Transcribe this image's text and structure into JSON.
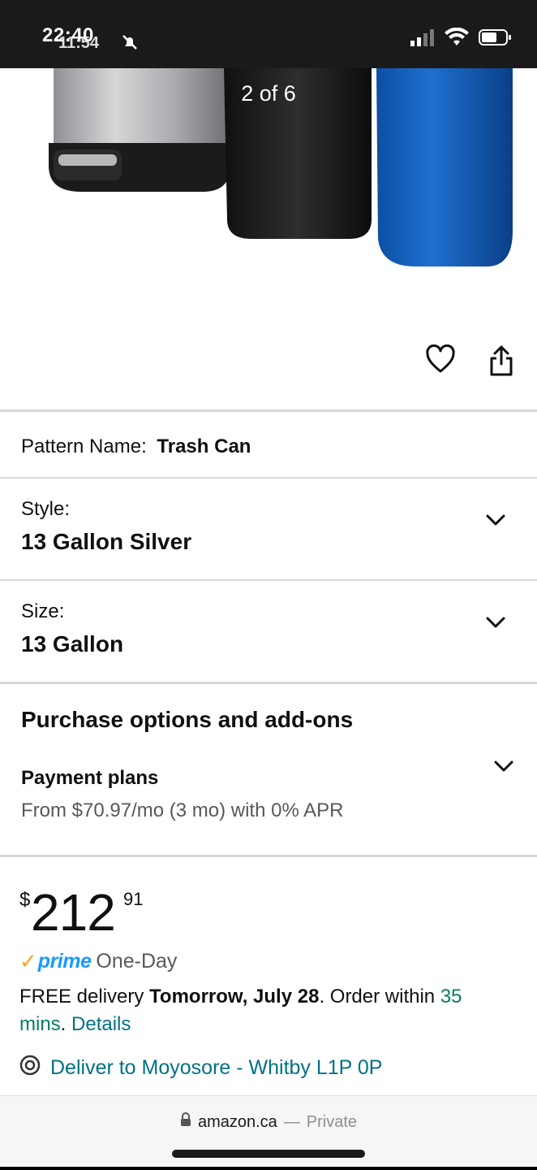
{
  "status_bar": {
    "time": "22:40",
    "time_overlay": "11:54"
  },
  "gallery": {
    "counter": "2 of 6"
  },
  "options": {
    "pattern_label": "Pattern Name:",
    "pattern_value": "Trash Can",
    "style_label": "Style:",
    "style_value": "13 Gallon Silver",
    "size_label": "Size:",
    "size_value": "13 Gallon"
  },
  "purchase": {
    "title": "Purchase options and add-ons",
    "payment_title": "Payment plans",
    "payment_sub": "From $70.97/mo (3 mo) with 0% APR"
  },
  "price": {
    "symbol": "$",
    "whole": "212",
    "fraction": "91"
  },
  "prime": {
    "check": "✓",
    "word": "prime",
    "speed": "One-Day"
  },
  "delivery": {
    "prefix": "FREE delivery ",
    "date": "Tomorrow, July 28",
    "mid": ". Order within ",
    "countdown_a": "35",
    "countdown_b": "mins",
    "sep": ". ",
    "details": "Details"
  },
  "deliver_to": "Deliver to Moyosore - Whitby L1P 0P",
  "browser": {
    "domain": "amazon.ca",
    "dash": "—",
    "private": "Private"
  },
  "colors": {
    "link": "#007185",
    "green": "#067d62",
    "prime_blue": "#1a98ff",
    "prime_check": "#f5a623"
  }
}
